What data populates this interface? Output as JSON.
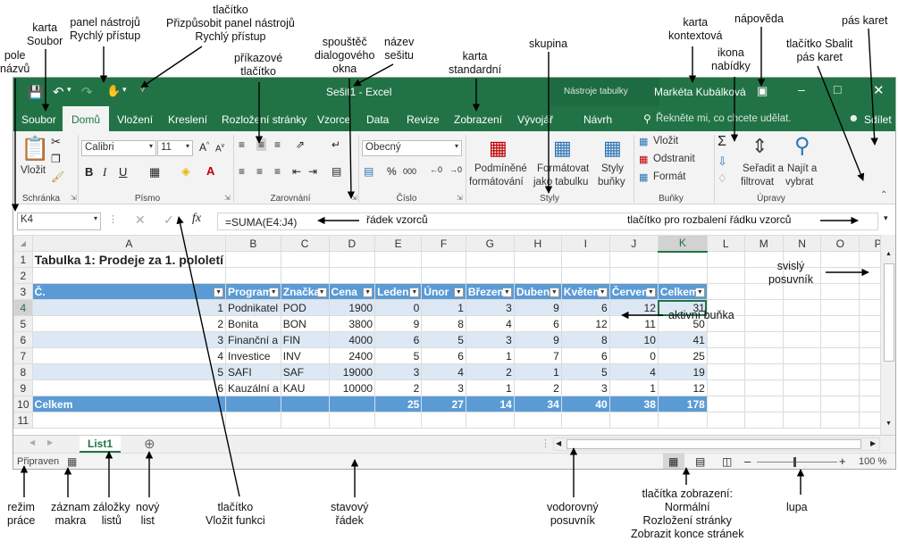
{
  "title_bar": {
    "workbook_title": "Sešit1 - Excel",
    "context_title": "Nástroje tabulky",
    "user": "Markéta Kubálková"
  },
  "tabs": [
    "Soubor",
    "Domů",
    "Vložení",
    "Kreslení",
    "Rozložení stránky",
    "Vzorce",
    "Data",
    "Revize",
    "Zobrazení",
    "Vývojář",
    "Návrh"
  ],
  "tell_me": "Řekněte mi, co chcete udělat.",
  "share": "Sdílet",
  "ribbon": {
    "paste": "Vložit",
    "font_name": "Calibri",
    "font_size": "11",
    "number_format": "Obecný",
    "bold": "B",
    "italic": "I",
    "underline": "U",
    "cond_format": [
      "Podmíněné",
      "formátování"
    ],
    "format_table": [
      "Formátovat",
      "jako tabulku"
    ],
    "cell_styles": [
      "Styly",
      "buňky"
    ],
    "insert": "Vložit",
    "delete": "Odstranit",
    "format": "Formát",
    "sort_filter": [
      "Seřadit a",
      "filtrovat"
    ],
    "find_select": [
      "Najít a",
      "vybrat"
    ],
    "groups": [
      "Schránka",
      "Písmo",
      "Zarovnání",
      "Číslo",
      "Styly",
      "Buňky",
      "Úpravy"
    ]
  },
  "formula_bar": {
    "name_box": "K4",
    "formula": "=SUMA(E4:J4)"
  },
  "columns": [
    "A",
    "B",
    "C",
    "D",
    "E",
    "F",
    "G",
    "H",
    "I",
    "J",
    "K",
    "L",
    "M",
    "N",
    "O",
    "P"
  ],
  "rows": [
    "1",
    "2",
    "3",
    "4",
    "5",
    "6",
    "7",
    "8",
    "9",
    "10",
    "11"
  ],
  "sheet": {
    "title": "Tabulka 1: Prodeje za 1. pololetí",
    "headers": [
      "Č.",
      "Program",
      "Značka",
      "Cena",
      "Leden",
      "Únor",
      "Březen",
      "Duben",
      "Květen",
      "Červen",
      "Celkem"
    ],
    "data": [
      [
        "1",
        "Podnikatel",
        "POD",
        "1900",
        "0",
        "1",
        "3",
        "9",
        "6",
        "12",
        "31"
      ],
      [
        "2",
        "Bonita",
        "BON",
        "3800",
        "9",
        "8",
        "4",
        "6",
        "12",
        "11",
        "50"
      ],
      [
        "3",
        "Finanční a",
        "FIN",
        "4000",
        "6",
        "5",
        "3",
        "9",
        "8",
        "10",
        "41"
      ],
      [
        "4",
        "Investice",
        "INV",
        "2400",
        "5",
        "6",
        "1",
        "7",
        "6",
        "0",
        "25"
      ],
      [
        "5",
        "SAFI",
        "SAF",
        "19000",
        "3",
        "4",
        "2",
        "1",
        "5",
        "4",
        "19"
      ],
      [
        "6",
        "Kauzální a",
        "KAU",
        "10000",
        "2",
        "3",
        "1",
        "2",
        "3",
        "1",
        "12"
      ]
    ],
    "totals": [
      "Celkem",
      "",
      "",
      "",
      "25",
      "27",
      "14",
      "34",
      "40",
      "38",
      "178"
    ]
  },
  "sheet_tab": "List1",
  "status": {
    "mode": "Připraven",
    "zoom": "100 %"
  },
  "annotations": {
    "karta_soubor": [
      "karta",
      "Soubor"
    ],
    "qat": [
      "panel nástrojů",
      "Rychlý přístup"
    ],
    "customize_qat": [
      "tlačítko",
      "Přizpůsobit panel nástrojů",
      "Rychlý přístup"
    ],
    "launcher": [
      "spouštěč",
      "dialogového",
      "okna"
    ],
    "workbook_name": [
      "název",
      "sešitu"
    ],
    "std_tab": [
      "karta",
      "standardní"
    ],
    "ctx_tab": [
      "karta",
      "kontextová"
    ],
    "help": "nápověda",
    "ribbon": "pás karet",
    "pole_nazvu": [
      "pole",
      "názvů"
    ],
    "cmd_buttons": [
      "příkazové",
      "tlačítko"
    ],
    "skupina": "skupina",
    "menu_icon": [
      "ikona",
      "nabídky"
    ],
    "collapse": [
      "tlačítko Sbalit",
      "pás karet"
    ],
    "formula_row": "řádek vzorců",
    "expand_formula": "tlačítko pro rozbalení řádku vzorců",
    "vscroll": [
      "svislý",
      "posuvník"
    ],
    "active_cell": "aktivní buňka",
    "mode": [
      "režim",
      "práce"
    ],
    "macro": [
      "záznam",
      "makra"
    ],
    "sheet_tabs": [
      "záložky",
      "listů"
    ],
    "new_sheet": [
      "nový",
      "list"
    ],
    "insert_fn": [
      "tlačítko",
      "Vložit funkci"
    ],
    "status_bar": [
      "stavový",
      "řádek"
    ],
    "hscroll": [
      "vodorovný",
      "posuvník"
    ],
    "view_buttons": [
      "tlačítka zobrazení:",
      "Normální",
      "Rozložení stránky",
      "Zobrazit konce stránek"
    ],
    "zoom": "lupa"
  },
  "colors": {
    "excel_green": "#217346",
    "table_header": "#5b9bd5",
    "table_band": "#dde8f5"
  }
}
